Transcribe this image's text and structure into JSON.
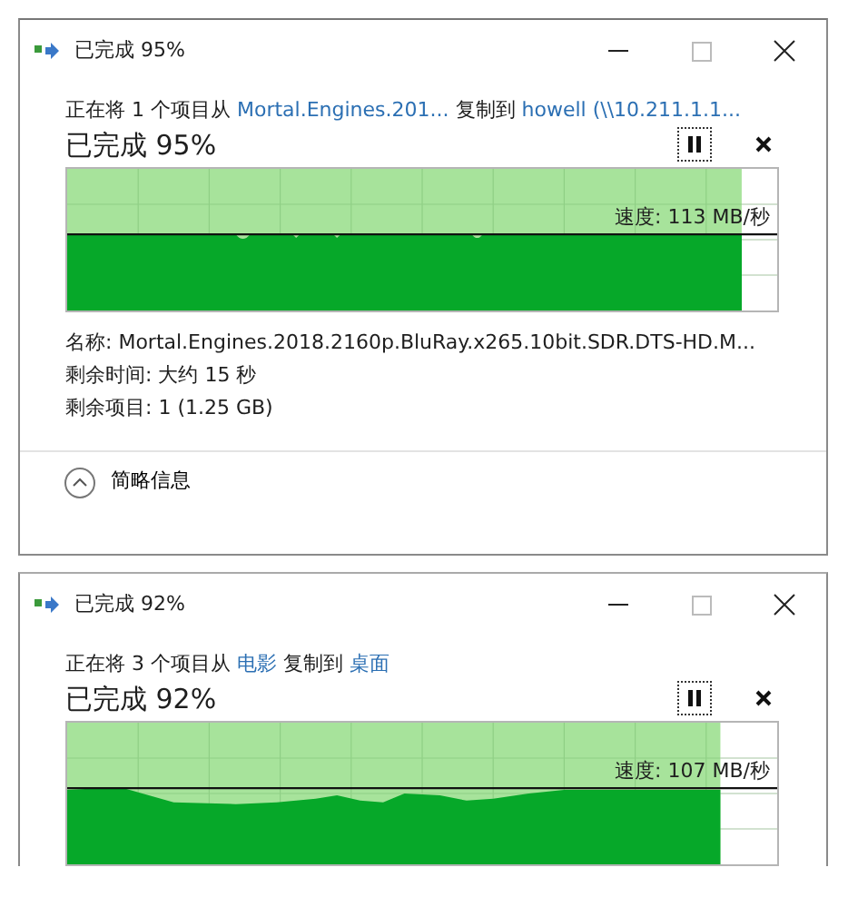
{
  "dialogs": [
    {
      "title": "已完成 95%",
      "copy_line": {
        "prefix": "正在将 1 个项目从",
        "source": "Mortal.Engines.201...",
        "middle": "复制到",
        "destination": "howell (\\\\10.211.1.1..."
      },
      "heading": "已完成 95%",
      "progress": {
        "level": 0.95
      },
      "speed": "速度: 113 MB/秒",
      "details": [
        "名称: Mortal.Engines.2018.2160p.BluRay.x265.10bit.SDR.DTS-HD.M...",
        "剩余时间: 大约 15 秒",
        "剩余项目: 1 (1.25 GB)"
      ],
      "toggle": "简略信息"
    },
    {
      "title": "已完成 92%",
      "copy_line": {
        "prefix": "正在将 3 个项目从",
        "source": "电影",
        "middle": "复制到",
        "destination": "桌面"
      },
      "heading": "已完成 92%",
      "progress": {
        "level": 0.92
      },
      "speed": "速度: 107 MB/秒"
    }
  ]
}
